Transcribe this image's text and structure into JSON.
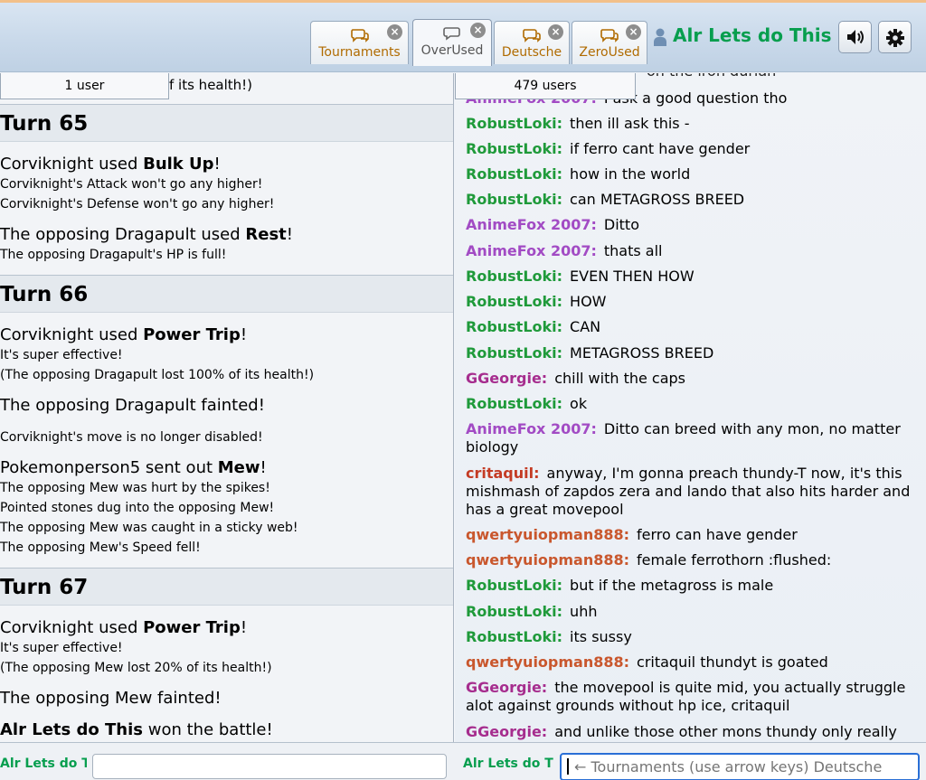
{
  "header": {
    "tabs": [
      {
        "label": "Tournaments",
        "active": false,
        "close": "×"
      },
      {
        "label": "OverUsed",
        "active": true,
        "close": "×"
      },
      {
        "label": "Deutsche",
        "active": false,
        "close": "×"
      },
      {
        "label": "ZeroUsed",
        "active": false,
        "close": "×"
      }
    ],
    "username": "Alr Lets do This",
    "sound_icon": "speaker-icon",
    "settings_icon": "gear-icon"
  },
  "battle": {
    "userlist_label": "1 user",
    "partial_top": "f its health!)",
    "turn65": {
      "title": "Turn 65",
      "line1_pre": "Corviknight used ",
      "line1_move": "Bulk Up",
      "line1_post": "!",
      "line2": "Corviknight's Attack won't go any higher!",
      "line3": "Corviknight's Defense won't go any higher!",
      "line4_pre": "The opposing Dragapult used ",
      "line4_move": "Rest",
      "line4_post": "!",
      "line5": "The opposing Dragapult's HP is full!"
    },
    "turn66": {
      "title": "Turn 66",
      "line1_pre": "Corviknight used ",
      "line1_move": "Power Trip",
      "line1_post": "!",
      "line2": "It's super effective!",
      "line3": "(The opposing Dragapult lost 100% of its health!)",
      "line4": "The opposing Dragapult fainted!",
      "line5": "Corviknight's move is no longer disabled!",
      "line6_pre": "Pokemonperson5 sent out ",
      "line6_mon": "Mew",
      "line6_post": "!",
      "line7": "The opposing Mew was hurt by the spikes!",
      "line8": "Pointed stones dug into the opposing Mew!",
      "line9": "The opposing Mew was caught in a sticky web!",
      "line10": "The opposing Mew's Speed fell!"
    },
    "turn67": {
      "title": "Turn 67",
      "line1_pre": "Corviknight used ",
      "line1_move": "Power Trip",
      "line1_post": "!",
      "line2": "It's super effective!",
      "line3": "(The opposing Mew lost 20% of its health!)",
      "line4": "The opposing Mew fainted!",
      "line5_winner": "Alr Lets do This",
      "line5_post": " won the battle!"
    },
    "bottom_name": "Alr Lets do T",
    "input_value": ""
  },
  "chat": {
    "userlist_label": "479 users",
    "partial_top": "on the iron durian",
    "messages": [
      {
        "user": "AnimeFox 2007:",
        "text": "I ask a good question tho"
      },
      {
        "user": "RobustLoki:",
        "text": "then ill ask this -"
      },
      {
        "user": "RobustLoki:",
        "text": "if ferro cant have gender"
      },
      {
        "user": "RobustLoki:",
        "text": "how in the world"
      },
      {
        "user": "RobustLoki:",
        "text": "can METAGROSS BREED"
      },
      {
        "user": "AnimeFox 2007:",
        "text": "Ditto"
      },
      {
        "user": "AnimeFox 2007:",
        "text": "thats all"
      },
      {
        "user": "RobustLoki:",
        "text": "EVEN THEN HOW"
      },
      {
        "user": "RobustLoki:",
        "text": "HOW"
      },
      {
        "user": "RobustLoki:",
        "text": "CAN"
      },
      {
        "user": "RobustLoki:",
        "text": "METAGROSS BREED"
      },
      {
        "user": "GGeorgie:",
        "text": "chill with the caps"
      },
      {
        "user": "RobustLoki:",
        "text": "ok"
      },
      {
        "user": "AnimeFox 2007:",
        "text": "Ditto can breed with any mon, no matter biology"
      },
      {
        "user": "critaquil:",
        "text": "anyway, I'm gonna preach thundy-T now, it's this mishmash of zapdos zera and lando that also hits harder and has a great movepool"
      },
      {
        "user": "qwertyuiopman888:",
        "text": "ferro can have gender"
      },
      {
        "user": "qwertyuiopman888:",
        "text": "female ferrothorn :flushed:"
      },
      {
        "user": "RobustLoki:",
        "text": "but if the metagross is male"
      },
      {
        "user": "RobustLoki:",
        "text": "uhh"
      },
      {
        "user": "RobustLoki:",
        "text": "its sussy"
      },
      {
        "user": "qwertyuiopman888:",
        "text": "critaquil thundyt is goated"
      },
      {
        "user": "GGeorgie:",
        "text": "the movepool is quite mid, you actually struggle alot against grounds without hp ice, critaquil"
      },
      {
        "user": "GGeorgie:",
        "text": "and unlike those other mons thundy only really"
      }
    ],
    "bottom_name": "Alr Lets do T",
    "input_placeholder": "← Tournaments (use arrow keys) Deutsche"
  }
}
